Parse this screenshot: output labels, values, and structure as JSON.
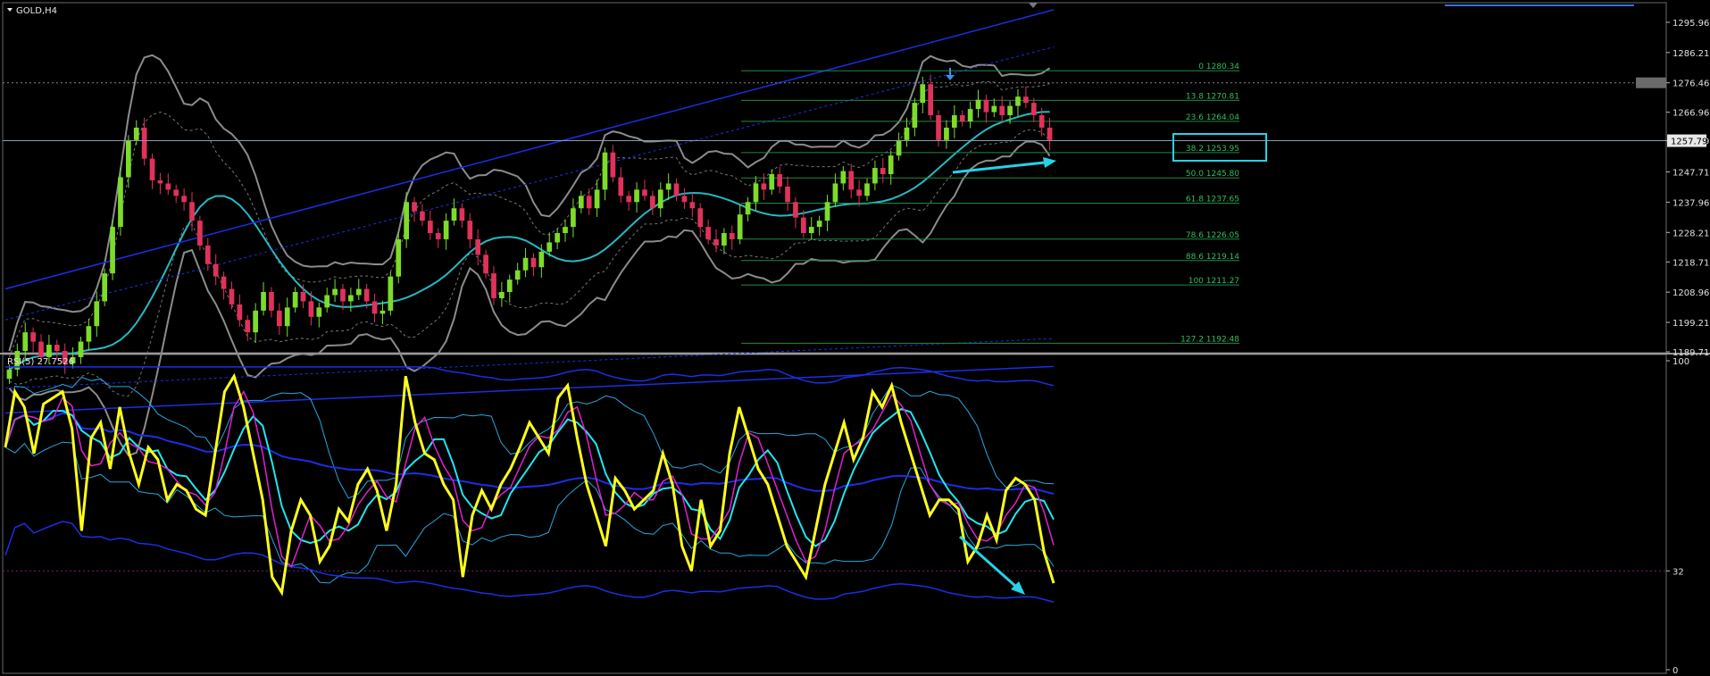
{
  "window": {
    "title": "GOLD,H4"
  },
  "colors": {
    "background": "#000000",
    "bull_candle": "#7ddc2a",
    "bear_candle": "#e0325a",
    "fib": "#1f8a45",
    "fib_text": "#2fbf5f",
    "bands_outer": "#8c8c8c",
    "midline": "#25b9c2",
    "rsi": "#ffff1a",
    "rsi_signal": "#e020d0",
    "rsi_fast": "#20e6f0",
    "envelope": "#1a2fe6",
    "arrow": "#26d3e6",
    "highlight_box": "#26d3e6",
    "level32": "#7a2070"
  },
  "chart_data": [
    {
      "type": "candlestick",
      "title": "GOLD,H4",
      "ylim": [
        1189.71,
        1302
      ],
      "y_ticks": [
        "1295.96",
        "1286.21",
        "1276.46",
        "1266.96",
        "1257.79",
        "1247.71",
        "1237.96",
        "1228.21",
        "1218.71",
        "1208.96",
        "1199.21",
        "1189.71"
      ],
      "current_price": "1257.79",
      "fibonacci": {
        "x_range": [
          0.52,
          0.66
        ],
        "levels": [
          {
            "label": "0 1280.34",
            "price": 1280.34
          },
          {
            "label": "13.8 1270.81",
            "price": 1270.81
          },
          {
            "label": "23.6 1264.04",
            "price": 1264.04
          },
          {
            "label": "38.2 1253.95",
            "price": 1253.95
          },
          {
            "label": "50.0 1245.80",
            "price": 1245.8
          },
          {
            "label": "61.8 1237.65",
            "price": 1237.65
          },
          {
            "label": "78.6 1226.05",
            "price": 1226.05
          },
          {
            "label": "88.6 1219.14",
            "price": 1219.14
          },
          {
            "label": "100 1211.27",
            "price": 1211.27
          },
          {
            "label": "127.2 1192.48",
            "price": 1192.48
          }
        ],
        "highlighted": "38.2 1253.95"
      },
      "closes": [
        1184,
        1190,
        1196,
        1193,
        1188,
        1192,
        1190,
        1186,
        1188,
        1193,
        1198,
        1206,
        1215,
        1230,
        1246,
        1258,
        1262,
        1252,
        1245,
        1244,
        1242,
        1240,
        1238,
        1232,
        1224,
        1218,
        1214,
        1210,
        1205,
        1200,
        1196,
        1203,
        1209,
        1203,
        1198,
        1204,
        1209,
        1206,
        1201,
        1204,
        1208,
        1210,
        1206,
        1208,
        1210,
        1206,
        1202,
        1203,
        1214,
        1226,
        1238,
        1235,
        1232,
        1228,
        1226,
        1232,
        1236,
        1232,
        1226,
        1221,
        1215,
        1207,
        1209,
        1213,
        1216,
        1220,
        1217,
        1222,
        1225,
        1228,
        1230,
        1236,
        1240,
        1236,
        1242,
        1254,
        1246,
        1240,
        1238,
        1242,
        1240,
        1236,
        1242,
        1244,
        1240,
        1238,
        1236,
        1230,
        1226,
        1224,
        1228,
        1226,
        1234,
        1238,
        1244,
        1242,
        1247,
        1243,
        1238,
        1233,
        1228,
        1230,
        1232,
        1238,
        1244,
        1248,
        1242,
        1240,
        1244,
        1249,
        1247,
        1253,
        1258,
        1262,
        1270,
        1276,
        1266,
        1258,
        1262,
        1266,
        1264,
        1268,
        1271,
        1267,
        1269,
        1266,
        1269,
        1272,
        1270,
        1266,
        1262,
        1258
      ],
      "overlays": {
        "middle_band_start_end": [
          1198,
          1262
        ],
        "outer_envelope_start_end": [
          1180,
          1300
        ]
      },
      "annotations": [
        {
          "type": "arrow",
          "direction": "up-right",
          "note": "price support trend"
        },
        {
          "type": "marker",
          "shape": "down-arrow",
          "at": "swing high"
        }
      ]
    },
    {
      "type": "line",
      "title": "RSI(5) 27.7526",
      "ylim": [
        0,
        100
      ],
      "y_ticks": [
        "100",
        "32",
        "0"
      ],
      "reference_level": 32,
      "series": [
        {
          "values": [
            72,
            90,
            85,
            70,
            86,
            88,
            90,
            78,
            45,
            75,
            80,
            65,
            85,
            70,
            60,
            72,
            68,
            55,
            60,
            58,
            52,
            50,
            70,
            90,
            95,
            85,
            70,
            55,
            30,
            25,
            45,
            55,
            50,
            35,
            40,
            52,
            48,
            60,
            65,
            58,
            45,
            60,
            95,
            80,
            70,
            68,
            60,
            55,
            30,
            50,
            58,
            52,
            60,
            65,
            72,
            80,
            75,
            70,
            88,
            92,
            75,
            60,
            50,
            40,
            62,
            58,
            52,
            55,
            58,
            70,
            60,
            40,
            32,
            55,
            40,
            45,
            70,
            85,
            75,
            65,
            60,
            50,
            40,
            35,
            30,
            45,
            60,
            70,
            80,
            68,
            75,
            90,
            85,
            92,
            80,
            70,
            60,
            50,
            55,
            55,
            52,
            35,
            40,
            50,
            42,
            58,
            62,
            60,
            55,
            38,
            28
          ]
        }
      ],
      "annotations": [
        {
          "type": "arrow",
          "direction": "down-right",
          "note": "RSI falling"
        }
      ]
    }
  ]
}
